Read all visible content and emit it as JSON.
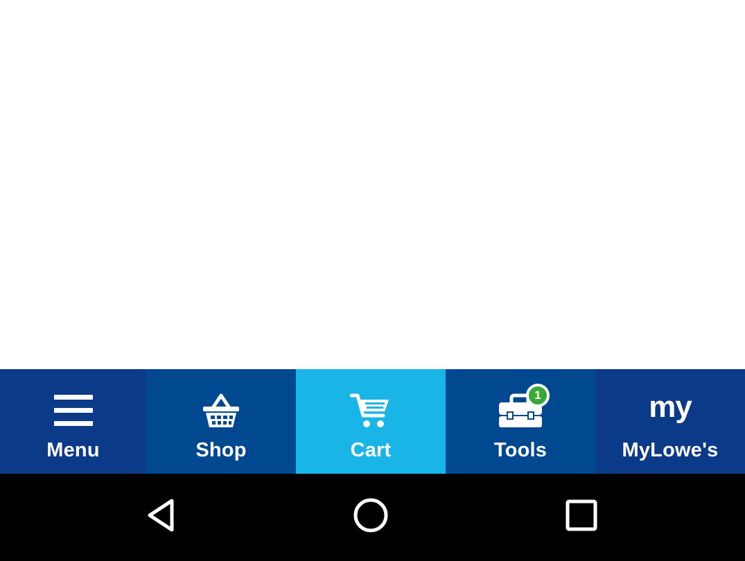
{
  "nav": {
    "items": [
      {
        "label": "Menu",
        "icon": "hamburger-menu-icon",
        "bg": "#0a3a88"
      },
      {
        "label": "Shop",
        "icon": "shopping-basket-icon",
        "bg": "#004990"
      },
      {
        "label": "Cart",
        "icon": "shopping-cart-icon",
        "bg": "#19b5e6"
      },
      {
        "label": "Tools",
        "icon": "toolbox-icon",
        "bg": "#004990",
        "badge": "1"
      },
      {
        "label": "MyLowe's",
        "icon_text": "my",
        "icon": "my-lowes-icon",
        "bg": "#0a3a88"
      }
    ]
  },
  "colors": {
    "nav_dark": "#0a3a88",
    "nav_mid": "#004990",
    "nav_active": "#19b5e6",
    "badge_green": "#3aa835",
    "system_bar": "#000000"
  },
  "system_bar": {
    "buttons": [
      "back-icon",
      "home-icon",
      "recents-icon"
    ]
  }
}
